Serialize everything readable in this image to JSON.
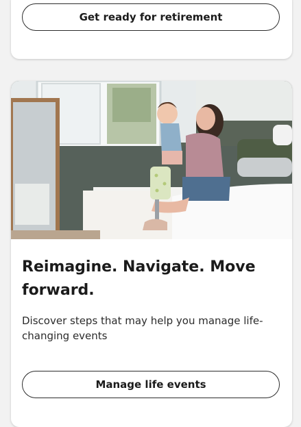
{
  "retirement_card": {
    "button_label": "Get ready for retirement"
  },
  "life_events_card": {
    "image": "mother-holding-toddler-on-bed",
    "headline": "Reimagine. Navigate. Move forward.",
    "description": "Discover steps that may help you manage life-changing events",
    "button_label": "Manage life events"
  }
}
